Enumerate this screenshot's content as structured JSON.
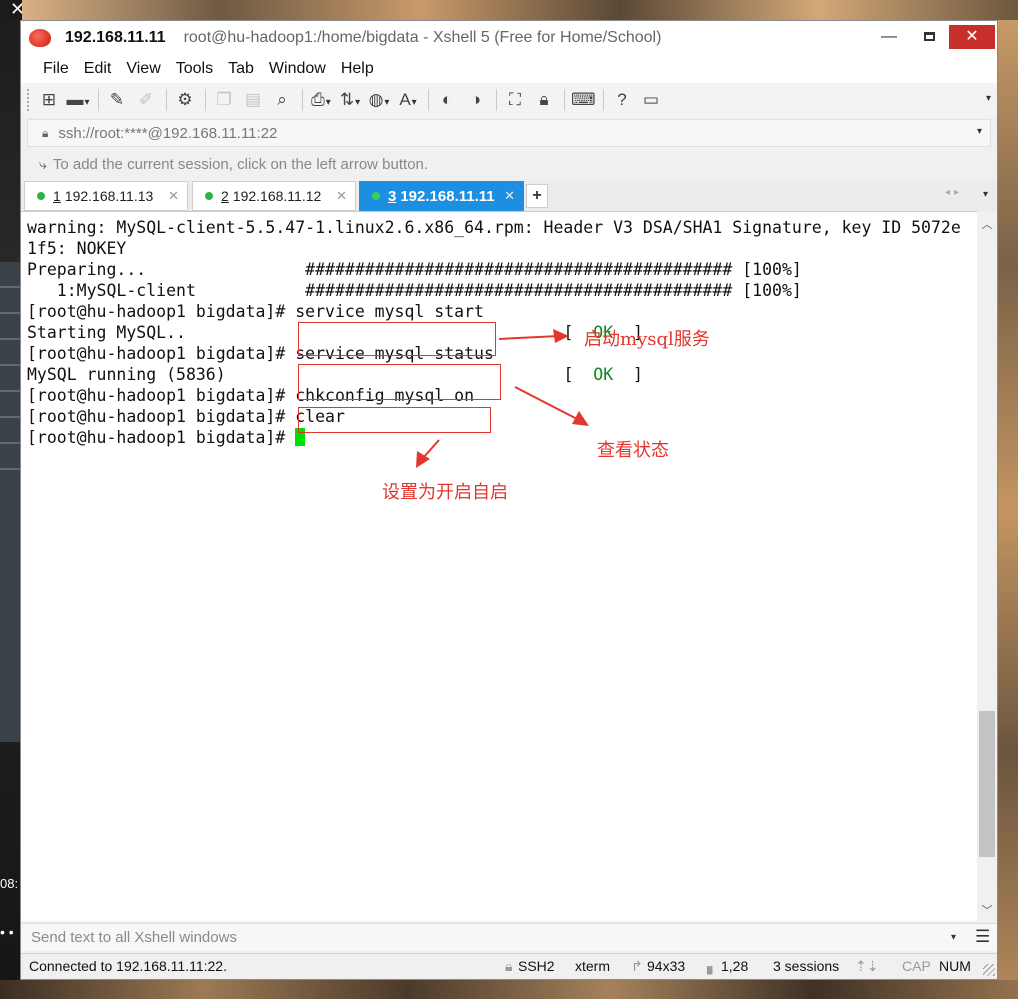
{
  "window": {
    "title_ip": "192.168.11.11",
    "title_rest": "root@hu-hadoop1:/home/bigdata - Xshell 5 (Free for Home/School)"
  },
  "menu": [
    "File",
    "Edit",
    "View",
    "Tools",
    "Tab",
    "Window",
    "Help"
  ],
  "address": {
    "url": "ssh://root:****@192.168.11.11:22"
  },
  "hint": "To add the current session, click on the left arrow button.",
  "tabs": [
    {
      "num": "1",
      "label": "192.168.11.13",
      "active": false
    },
    {
      "num": "2",
      "label": "192.168.11.12",
      "active": false
    },
    {
      "num": "3",
      "label": "192.168.11.11",
      "active": true
    }
  ],
  "terminal": {
    "lines": [
      "warning: MySQL-client-5.5.47-1.linux2.6.x86_64.rpm: Header V3 DSA/SHA1 Signature, key ID 5072e",
      "1f5: NOKEY",
      "Preparing...                ########################################### [100%]",
      "   1:MySQL-client           ########################################### [100%]",
      "[root@hu-hadoop1 bigdata]# service mysql start",
      "Starting MySQL..",
      "[root@hu-hadoop1 bigdata]# service mysql status",
      "MySQL running (5836)",
      "[root@hu-hadoop1 bigdata]# chkconfig mysql on",
      "[root@hu-hadoop1 bigdata]# clear",
      "[root@hu-hadoop1 bigdata]# "
    ],
    "ok_open": "[  ",
    "ok_word": "OK",
    "ok_close": "  ]"
  },
  "annotations": {
    "start_service": "启动mysql服务",
    "check_status": "查看状态",
    "set_autostart": "设置为开启自启"
  },
  "send_bar": {
    "placeholder": "Send text to all Xshell windows"
  },
  "status": {
    "connected": "Connected to 192.168.11.11:22.",
    "protocol": "SSH2",
    "terminal_type": "xterm",
    "size": "94x33",
    "cursor_pos": "1,28",
    "sessions": "3 sessions",
    "cap": "CAP",
    "num": "NUM"
  },
  "colors": {
    "active_tab": "#1e8fe0",
    "annotation": "#e3362e",
    "ok_text": "#0d8a1f",
    "cursor": "#00e000"
  }
}
